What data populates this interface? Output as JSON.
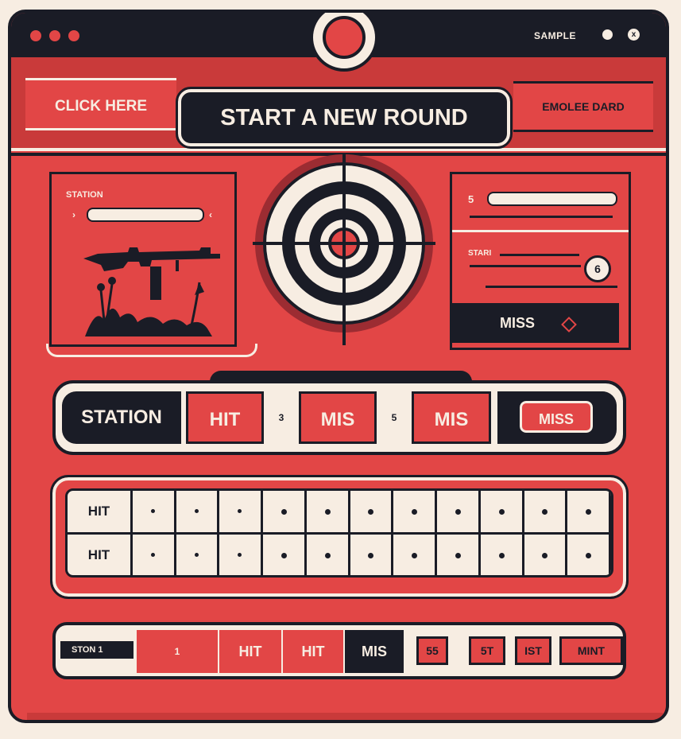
{
  "window": {
    "title_text": "SAMPLE",
    "close_glyph": "x"
  },
  "header": {
    "click_here": "CLICK HERE",
    "start_round": "START A NEW ROUND",
    "right_label": "EMOLEE DARD"
  },
  "station_panel": {
    "label": "STATION",
    "chevron_left": "›",
    "chevron_right": "‹"
  },
  "right_panel": {
    "number": "5",
    "start_label": "STARI",
    "badge": "6",
    "miss_label": "MISS"
  },
  "station_row": {
    "station": "STATION",
    "cell1": "HIT",
    "num1": "3",
    "cell2": "MIS",
    "num2": "5",
    "cell3": "MIS",
    "button": "MISS"
  },
  "grid": {
    "rows": [
      {
        "label": "HIT"
      },
      {
        "label": "HIT"
      }
    ],
    "dots_per_row": 11
  },
  "bottom_row": {
    "station": "STON 1",
    "cell1": "1",
    "cell2": "HIT",
    "cell3": "HIT",
    "cell4": "MIS",
    "small1": "55",
    "small2": "5T",
    "small3": "IST",
    "small4": "MINT"
  },
  "colors": {
    "primary_red": "#e24646",
    "dark": "#1a1c26",
    "cream": "#f7ede2"
  }
}
